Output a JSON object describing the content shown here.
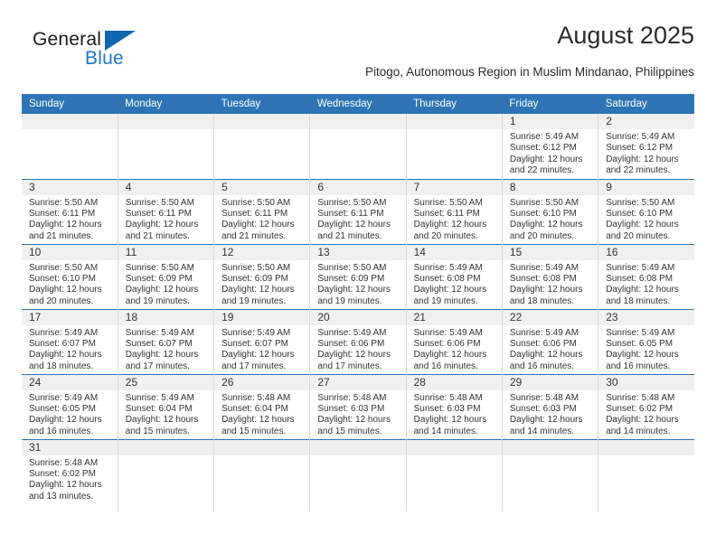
{
  "brand": {
    "name_top": "General",
    "name_bottom": "Blue",
    "triangle_color": "#1166b0",
    "blue_color": "#2277c8"
  },
  "header": {
    "title": "August 2025",
    "subtitle": "Pitogo, Autonomous Region in Muslim Mindanao, Philippines"
  },
  "colors": {
    "header_blue": "#2e74b5",
    "daynum_band": "#f0f0f0",
    "cell_border": "#d8d8d8",
    "text": "#333333"
  },
  "calendar": {
    "weekdays": [
      "Sunday",
      "Monday",
      "Tuesday",
      "Wednesday",
      "Thursday",
      "Friday",
      "Saturday"
    ],
    "weeks": [
      [
        {
          "day": "",
          "lines": []
        },
        {
          "day": "",
          "lines": []
        },
        {
          "day": "",
          "lines": []
        },
        {
          "day": "",
          "lines": []
        },
        {
          "day": "",
          "lines": []
        },
        {
          "day": "1",
          "lines": [
            "Sunrise: 5:49 AM",
            "Sunset: 6:12 PM",
            "Daylight: 12 hours",
            "and 22 minutes."
          ]
        },
        {
          "day": "2",
          "lines": [
            "Sunrise: 5:49 AM",
            "Sunset: 6:12 PM",
            "Daylight: 12 hours",
            "and 22 minutes."
          ]
        }
      ],
      [
        {
          "day": "3",
          "lines": [
            "Sunrise: 5:50 AM",
            "Sunset: 6:11 PM",
            "Daylight: 12 hours",
            "and 21 minutes."
          ]
        },
        {
          "day": "4",
          "lines": [
            "Sunrise: 5:50 AM",
            "Sunset: 6:11 PM",
            "Daylight: 12 hours",
            "and 21 minutes."
          ]
        },
        {
          "day": "5",
          "lines": [
            "Sunrise: 5:50 AM",
            "Sunset: 6:11 PM",
            "Daylight: 12 hours",
            "and 21 minutes."
          ]
        },
        {
          "day": "6",
          "lines": [
            "Sunrise: 5:50 AM",
            "Sunset: 6:11 PM",
            "Daylight: 12 hours",
            "and 21 minutes."
          ]
        },
        {
          "day": "7",
          "lines": [
            "Sunrise: 5:50 AM",
            "Sunset: 6:11 PM",
            "Daylight: 12 hours",
            "and 20 minutes."
          ]
        },
        {
          "day": "8",
          "lines": [
            "Sunrise: 5:50 AM",
            "Sunset: 6:10 PM",
            "Daylight: 12 hours",
            "and 20 minutes."
          ]
        },
        {
          "day": "9",
          "lines": [
            "Sunrise: 5:50 AM",
            "Sunset: 6:10 PM",
            "Daylight: 12 hours",
            "and 20 minutes."
          ]
        }
      ],
      [
        {
          "day": "10",
          "lines": [
            "Sunrise: 5:50 AM",
            "Sunset: 6:10 PM",
            "Daylight: 12 hours",
            "and 20 minutes."
          ]
        },
        {
          "day": "11",
          "lines": [
            "Sunrise: 5:50 AM",
            "Sunset: 6:09 PM",
            "Daylight: 12 hours",
            "and 19 minutes."
          ]
        },
        {
          "day": "12",
          "lines": [
            "Sunrise: 5:50 AM",
            "Sunset: 6:09 PM",
            "Daylight: 12 hours",
            "and 19 minutes."
          ]
        },
        {
          "day": "13",
          "lines": [
            "Sunrise: 5:50 AM",
            "Sunset: 6:09 PM",
            "Daylight: 12 hours",
            "and 19 minutes."
          ]
        },
        {
          "day": "14",
          "lines": [
            "Sunrise: 5:49 AM",
            "Sunset: 6:08 PM",
            "Daylight: 12 hours",
            "and 19 minutes."
          ]
        },
        {
          "day": "15",
          "lines": [
            "Sunrise: 5:49 AM",
            "Sunset: 6:08 PM",
            "Daylight: 12 hours",
            "and 18 minutes."
          ]
        },
        {
          "day": "16",
          "lines": [
            "Sunrise: 5:49 AM",
            "Sunset: 6:08 PM",
            "Daylight: 12 hours",
            "and 18 minutes."
          ]
        }
      ],
      [
        {
          "day": "17",
          "lines": [
            "Sunrise: 5:49 AM",
            "Sunset: 6:07 PM",
            "Daylight: 12 hours",
            "and 18 minutes."
          ]
        },
        {
          "day": "18",
          "lines": [
            "Sunrise: 5:49 AM",
            "Sunset: 6:07 PM",
            "Daylight: 12 hours",
            "and 17 minutes."
          ]
        },
        {
          "day": "19",
          "lines": [
            "Sunrise: 5:49 AM",
            "Sunset: 6:07 PM",
            "Daylight: 12 hours",
            "and 17 minutes."
          ]
        },
        {
          "day": "20",
          "lines": [
            "Sunrise: 5:49 AM",
            "Sunset: 6:06 PM",
            "Daylight: 12 hours",
            "and 17 minutes."
          ]
        },
        {
          "day": "21",
          "lines": [
            "Sunrise: 5:49 AM",
            "Sunset: 6:06 PM",
            "Daylight: 12 hours",
            "and 16 minutes."
          ]
        },
        {
          "day": "22",
          "lines": [
            "Sunrise: 5:49 AM",
            "Sunset: 6:06 PM",
            "Daylight: 12 hours",
            "and 16 minutes."
          ]
        },
        {
          "day": "23",
          "lines": [
            "Sunrise: 5:49 AM",
            "Sunset: 6:05 PM",
            "Daylight: 12 hours",
            "and 16 minutes."
          ]
        }
      ],
      [
        {
          "day": "24",
          "lines": [
            "Sunrise: 5:49 AM",
            "Sunset: 6:05 PM",
            "Daylight: 12 hours",
            "and 16 minutes."
          ]
        },
        {
          "day": "25",
          "lines": [
            "Sunrise: 5:49 AM",
            "Sunset: 6:04 PM",
            "Daylight: 12 hours",
            "and 15 minutes."
          ]
        },
        {
          "day": "26",
          "lines": [
            "Sunrise: 5:48 AM",
            "Sunset: 6:04 PM",
            "Daylight: 12 hours",
            "and 15 minutes."
          ]
        },
        {
          "day": "27",
          "lines": [
            "Sunrise: 5:48 AM",
            "Sunset: 6:03 PM",
            "Daylight: 12 hours",
            "and 15 minutes."
          ]
        },
        {
          "day": "28",
          "lines": [
            "Sunrise: 5:48 AM",
            "Sunset: 6:03 PM",
            "Daylight: 12 hours",
            "and 14 minutes."
          ]
        },
        {
          "day": "29",
          "lines": [
            "Sunrise: 5:48 AM",
            "Sunset: 6:03 PM",
            "Daylight: 12 hours",
            "and 14 minutes."
          ]
        },
        {
          "day": "30",
          "lines": [
            "Sunrise: 5:48 AM",
            "Sunset: 6:02 PM",
            "Daylight: 12 hours",
            "and 14 minutes."
          ]
        }
      ],
      [
        {
          "day": "31",
          "lines": [
            "Sunrise: 5:48 AM",
            "Sunset: 6:02 PM",
            "Daylight: 12 hours",
            "and 13 minutes."
          ]
        },
        {
          "day": "",
          "lines": []
        },
        {
          "day": "",
          "lines": []
        },
        {
          "day": "",
          "lines": []
        },
        {
          "day": "",
          "lines": []
        },
        {
          "day": "",
          "lines": []
        },
        {
          "day": "",
          "lines": []
        }
      ]
    ]
  }
}
